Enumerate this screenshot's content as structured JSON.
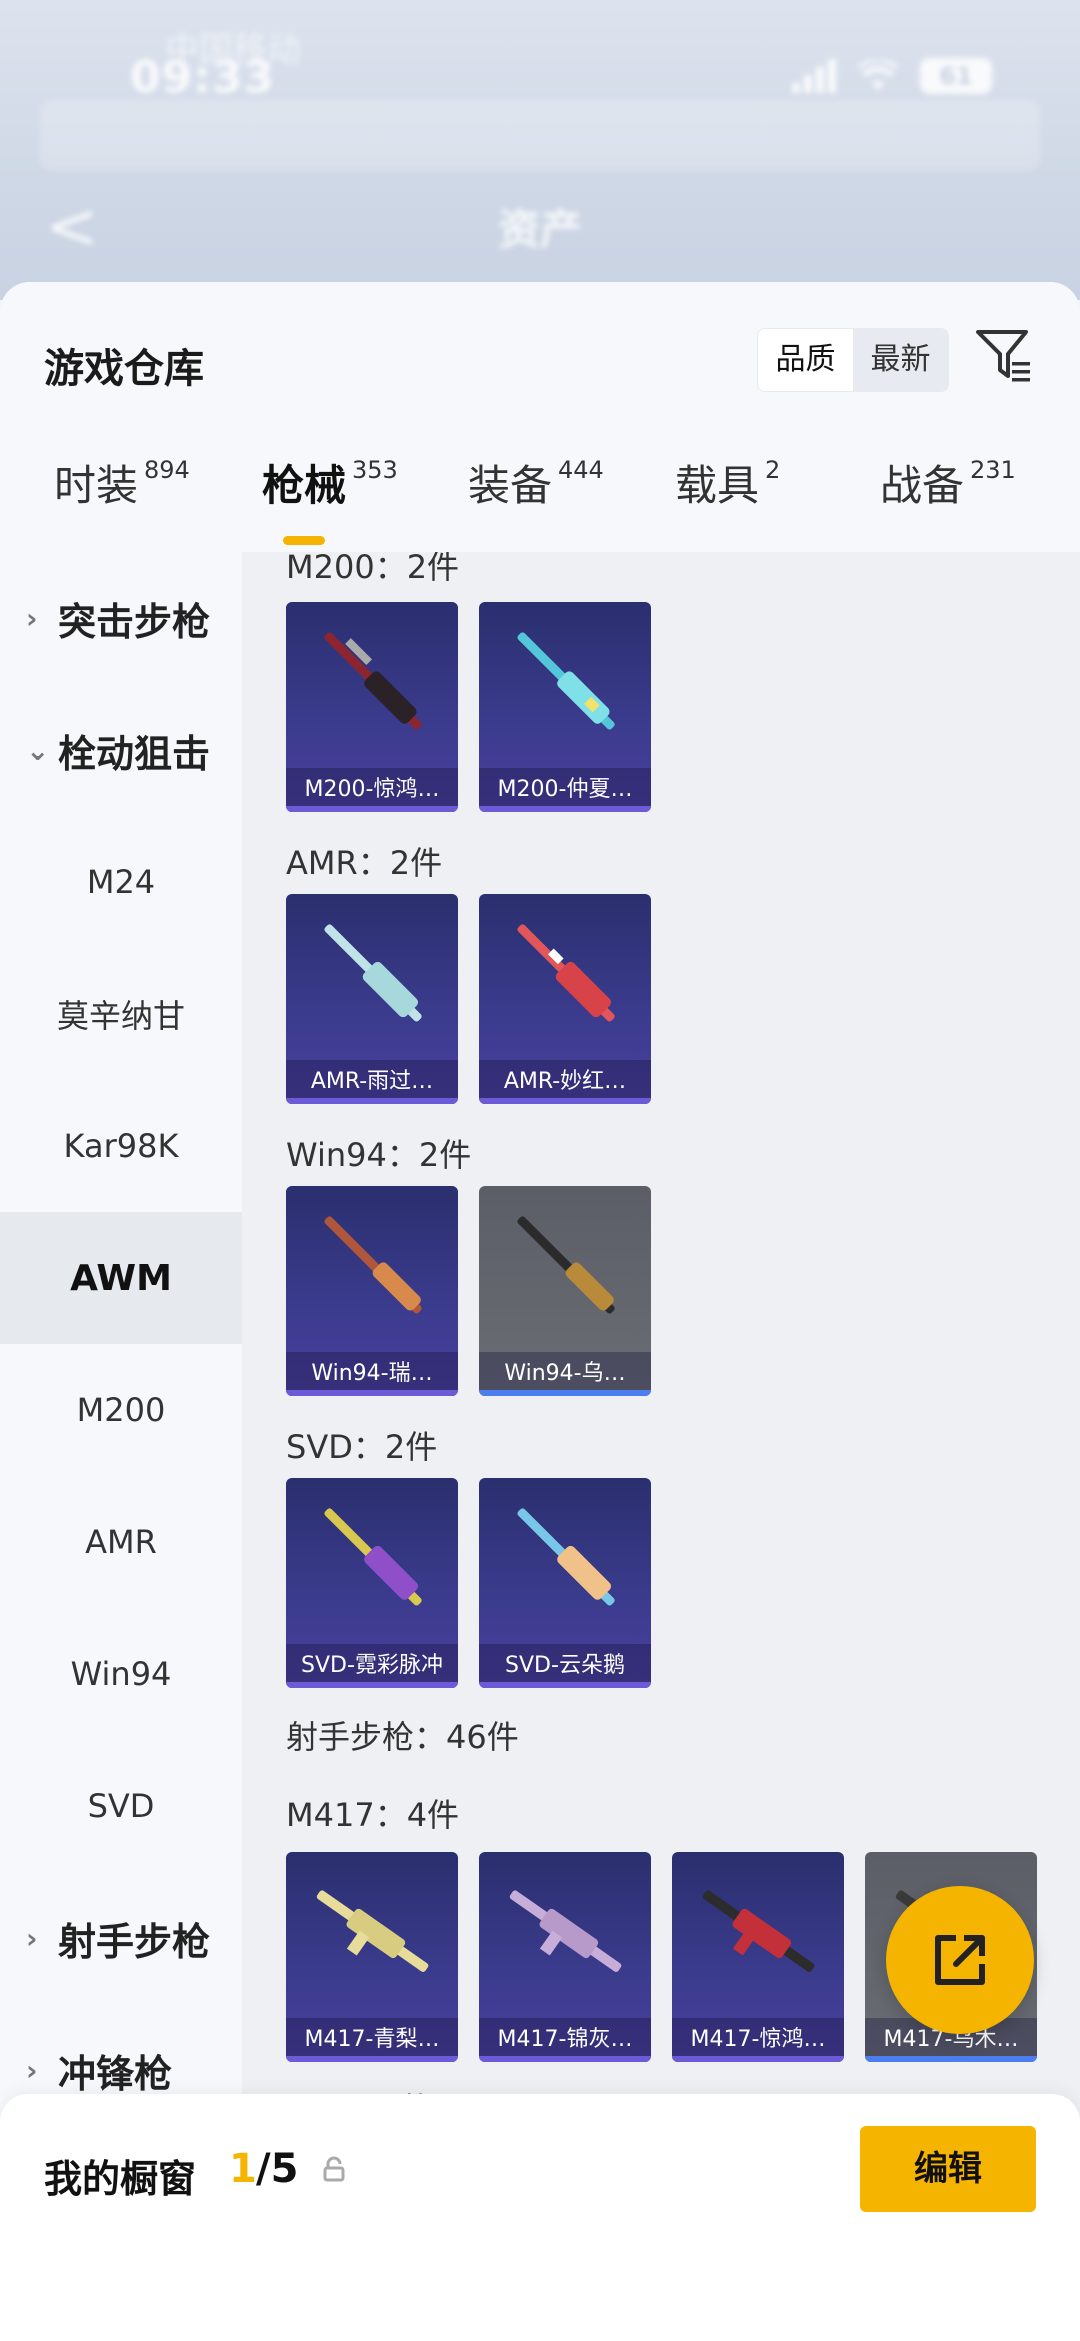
{
  "status_bar": {
    "time": "09:33",
    "battery": "61",
    "carrier": "中国移动"
  },
  "nav": {
    "title": "资产",
    "back_glyph": "<"
  },
  "header": {
    "title": "游戏仓库",
    "sort_quality": "品质",
    "sort_latest": "最新"
  },
  "tabs": [
    {
      "label": "时装",
      "count": "894"
    },
    {
      "label": "枪械",
      "count": "353"
    },
    {
      "label": "装备",
      "count": "444"
    },
    {
      "label": "载具",
      "count": "2"
    },
    {
      "label": "战备",
      "count": "231"
    }
  ],
  "sidebar": {
    "group_assault": "突击步枪",
    "group_bolt": "栓动狙击",
    "items": [
      "M24",
      "莫辛纳甘",
      "Kar98K",
      "AWM",
      "M200",
      "AMR",
      "Win94",
      "SVD"
    ],
    "group_marksman": "射手步枪",
    "group_smg": "冲锋枪",
    "chev_right": "›",
    "chev_down": "⌄"
  },
  "sections": {
    "m200": {
      "label": "M200：2件",
      "cards": [
        "M200-惊鸿…",
        "M200-仲夏…"
      ]
    },
    "amr": {
      "label": "AMR：2件",
      "cards": [
        "AMR-雨过…",
        "AMR-妙红…"
      ]
    },
    "win94": {
      "label": "Win94：2件",
      "cards": [
        "Win94-瑞…",
        "Win94-乌…"
      ]
    },
    "svd": {
      "label": "SVD：2件",
      "cards": [
        "SVD-霓彩脉冲",
        "SVD-云朵鹅"
      ]
    },
    "marksman": {
      "label": "射手步枪：46件"
    },
    "m417": {
      "label": "M417：4件",
      "cards": [
        "M417-青梨…",
        "M417-锦灰…",
        "M417-惊鸿…",
        "M417-乌木…"
      ]
    },
    "next": {
      "label": "SKS：2件"
    }
  },
  "bottom": {
    "window_label": "我的橱窗",
    "window_current": "1",
    "window_total": "/5",
    "edit": "编辑"
  },
  "colors": {
    "accent": "#f5b400",
    "card_purple": "#3a3b8c",
    "card_gray": "#6b6d74"
  },
  "icons": [
    "filter-icon",
    "lock-icon",
    "share-external-icon",
    "back-icon"
  ]
}
